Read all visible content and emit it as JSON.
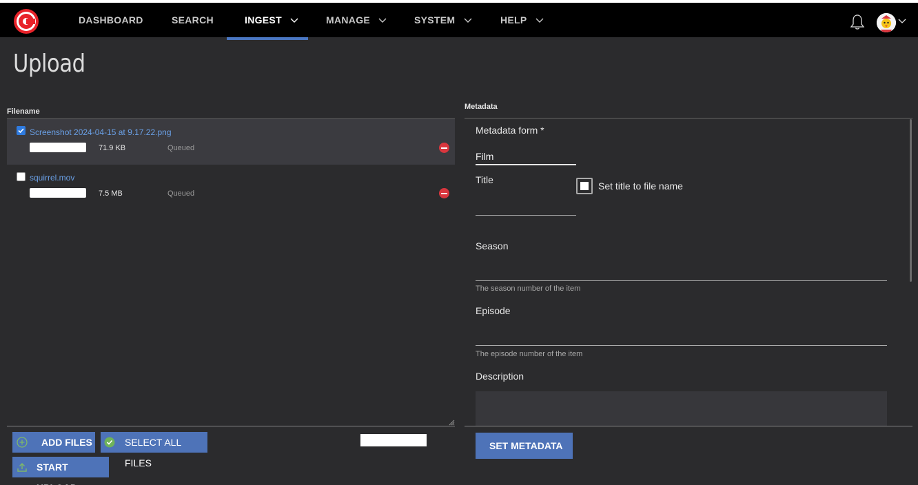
{
  "nav": {
    "items": [
      {
        "label": "DASHBOARD"
      },
      {
        "label": "SEARCH"
      },
      {
        "label": "INGEST"
      },
      {
        "label": "MANAGE"
      },
      {
        "label": "SYSTEM"
      },
      {
        "label": "HELP"
      }
    ],
    "active": "INGEST"
  },
  "page": {
    "title": "Upload"
  },
  "files": {
    "header": "Filename",
    "rows": [
      {
        "name": "Screenshot 2024-04-15 at 9.17.22.png",
        "size": "71.9 KB",
        "status": "Queued",
        "checked": true
      },
      {
        "name": "squirrel.mov",
        "size": "7.5 MB",
        "status": "Queued",
        "checked": false
      }
    ]
  },
  "buttons": {
    "add_files": "ADD FILES",
    "select_all": "SELECT ALL FILES",
    "start_upload": "START UPLOAD",
    "set_metadata": "SET METADATA"
  },
  "metadata": {
    "header": "Metadata",
    "form_label": "Metadata form *",
    "form_value": "Film",
    "title_label": "Title",
    "title_checkbox_label": "Set title to file name",
    "season_label": "Season",
    "season_help": "The season number of the item",
    "episode_label": "Episode",
    "episode_help": "The episode number of the item",
    "description_label": "Description"
  },
  "colors": {
    "accent": "#4e73b8",
    "topbar": "#000000",
    "background": "#2b2b2d",
    "link": "#6aa0e6",
    "danger": "#d9363e"
  },
  "icons": [
    "logo-icon",
    "chevron-down-icon",
    "bell-icon",
    "avatar-icon",
    "plus-circle-icon",
    "check-circle-icon",
    "upload-icon",
    "remove-icon"
  ]
}
